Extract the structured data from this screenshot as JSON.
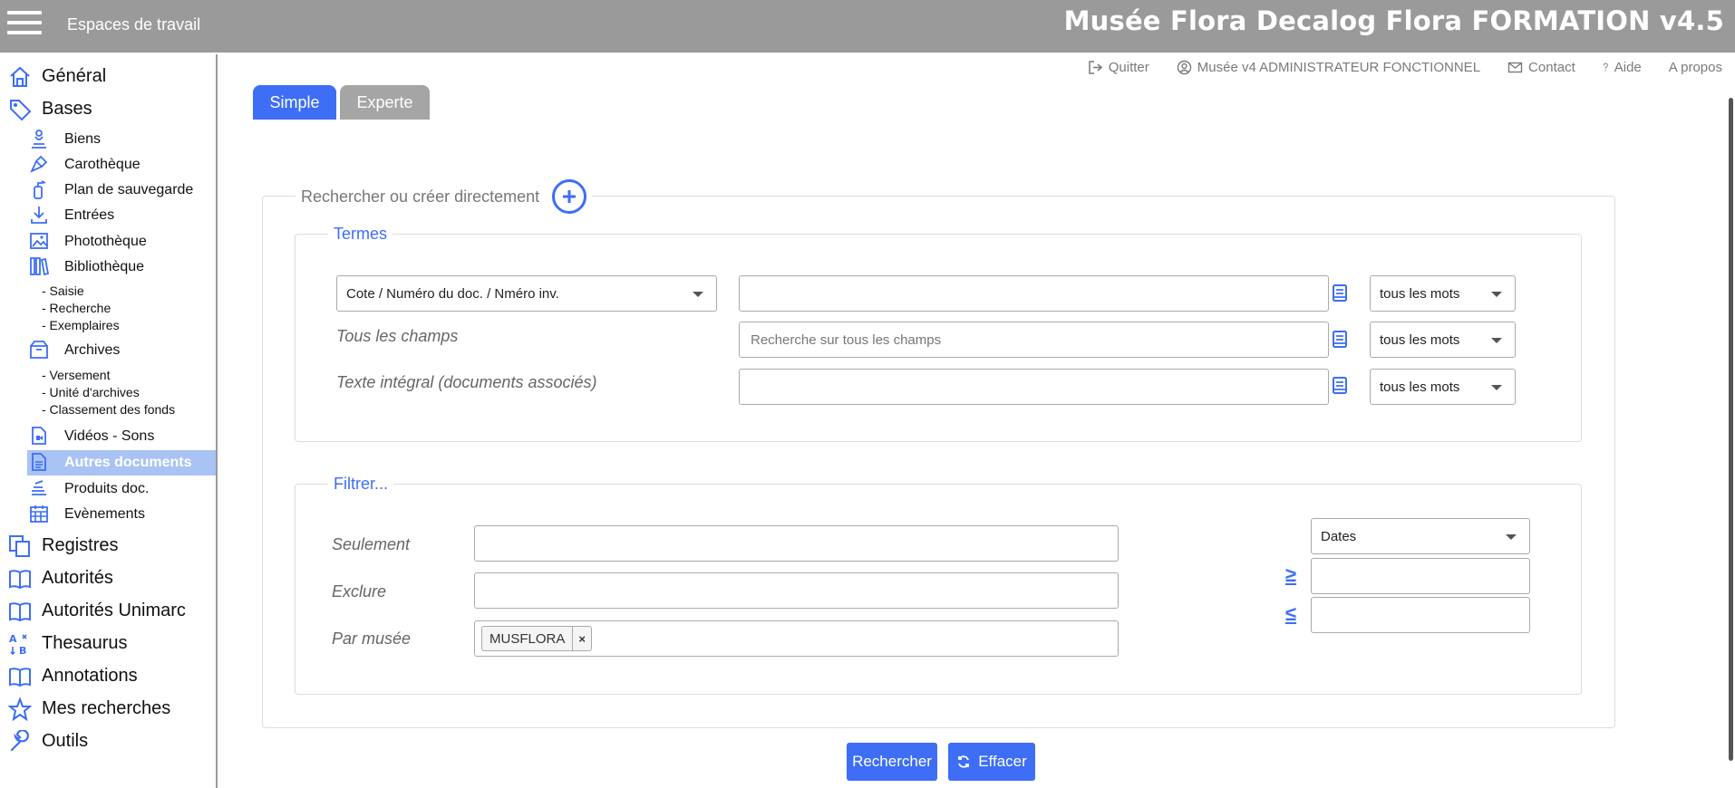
{
  "topbar": {
    "workspaces_label": "Espaces de travail",
    "app_title": "Musée Flora Decalog Flora FORMATION v4.5"
  },
  "colors": {
    "accent": "#3d6ef5",
    "topbar": "#9a9a9a",
    "active_item": "#a9c3f4",
    "inactive_tab": "#a5a5a5"
  },
  "sidebar": {
    "general": "Général",
    "bases": "Bases",
    "biens": "Biens",
    "carotheque": "Carothèque",
    "plan": "Plan de sauvegarde",
    "entrees": "Entrées",
    "phototheque": "Photothèque",
    "bibliotheque": "Bibliothèque",
    "biblio_saisie": "- Saisie",
    "biblio_recherche": "- Recherche",
    "biblio_exemplaires": "- Exemplaires",
    "archives": "Archives",
    "arch_versement": "- Versement",
    "arch_unite": "- Unité d'archives",
    "arch_classement": "- Classement des fonds",
    "videos": "Vidéos - Sons",
    "autres": "Autres documents",
    "produits": "Produits doc.",
    "evenements": "Evènements",
    "registres": "Registres",
    "autorites": "Autorités",
    "autorites_unimarc": "Autorités Unimarc",
    "thesaurus": "Thesaurus",
    "annotations": "Annotations",
    "mes_recherches": "Mes recherches",
    "outils": "Outils"
  },
  "toplinks": {
    "quitter": "Quitter",
    "user": "Musée v4 ADMINISTRATEUR FONCTIONNEL",
    "contact": "Contact",
    "aide": "Aide",
    "apropos": "A propos"
  },
  "tabs": {
    "simple": "Simple",
    "experte": "Experte"
  },
  "form": {
    "legend": "Rechercher ou créer directement",
    "termes": {
      "legend": "Termes",
      "field_select": "Cote / Numéro du doc. / Nméro inv.",
      "tous_champs_label": "Tous les champs",
      "tous_champs_placeholder": "Recherche sur tous les champs",
      "texte_integral_label": "Texte intégral (documents associés)",
      "mode_1": "tous les mots",
      "mode_2": "tous les mots",
      "mode_3": "tous les mots"
    },
    "filtrer": {
      "legend": "Filtrer...",
      "seulement": "Seulement",
      "exclure": "Exclure",
      "par_musee": "Par musée",
      "musee_tag": "MUSFLORA",
      "tag_remove": "×",
      "dates_select": "Dates",
      "gte": "≥",
      "lte": "≤"
    },
    "rechercher": "Rechercher",
    "effacer": "Effacer"
  }
}
